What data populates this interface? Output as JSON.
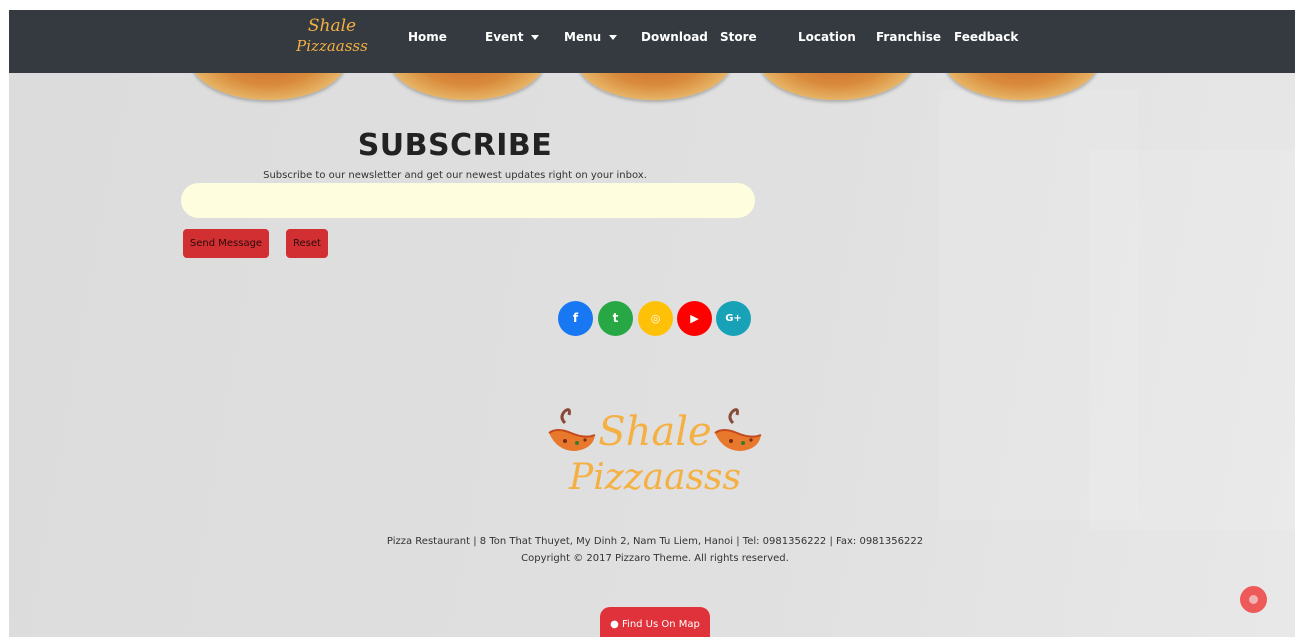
{
  "brand": {
    "logo_line1": "Shale",
    "logo_line2": "Pizzaasss"
  },
  "nav": {
    "home": "Home",
    "event": "Event",
    "menu": "Menu",
    "download": "Download",
    "store": "Store",
    "location": "Location",
    "franchise": "Franchise",
    "feedback": "Feedback"
  },
  "subscribe": {
    "title": "SUBSCRIBE",
    "subtitle": "Subscribe to our newsletter and get our newest updates right on your inbox.",
    "input_value": "",
    "send_label": "Send Message",
    "reset_label": "Reset"
  },
  "social": {
    "facebook": "f",
    "twitter": "t",
    "instagram": "◎",
    "youtube": "▶",
    "google": "G+"
  },
  "footer": {
    "address": "Pizza Restaurant | 8 Ton That Thuyet, My Dinh 2, Nam Tu Liem, Hanoi | Tel: 0981356222 | Fax: 0981356222",
    "copyright": "Copyright © 2017 Pizzaro Theme. All rights reserved.",
    "map_label": "Find Us On Map"
  },
  "colors": {
    "navbar": "#343a40",
    "accent_red": "#d22f32",
    "logo_orange": "#f5b043",
    "facebook": "#1877f2",
    "twitter": "#28a745",
    "instagram": "#ffc107",
    "youtube": "#ff0000",
    "google": "#17a2b8"
  },
  "icons": [
    "facebook-icon",
    "twitter-icon",
    "instagram-icon",
    "youtube-icon",
    "google-plus-icon",
    "map-marker-icon",
    "scroll-top-icon"
  ]
}
